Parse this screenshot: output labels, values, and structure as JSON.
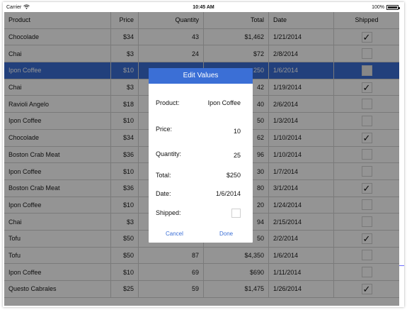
{
  "status_bar": {
    "carrier": "Carrier",
    "time": "10:45 AM",
    "battery": "100%"
  },
  "columns": [
    "Product",
    "Price",
    "Quantity",
    "Total",
    "Date",
    "Shipped"
  ],
  "rows": [
    {
      "product": "Chocolade",
      "price": "$34",
      "quantity": "43",
      "total": "$1,462",
      "date": "1/21/2014",
      "shipped": true
    },
    {
      "product": "Chai",
      "price": "$3",
      "quantity": "24",
      "total": "$72",
      "date": "2/8/2014",
      "shipped": false
    },
    {
      "product": "Ipon Coffee",
      "price": "$10",
      "quantity": "",
      "total": "250",
      "date": "1/6/2014",
      "shipped": false
    },
    {
      "product": "Chai",
      "price": "$3",
      "quantity": "",
      "total": "42",
      "date": "1/19/2014",
      "shipped": true
    },
    {
      "product": "Ravioli Angelo",
      "price": "$18",
      "quantity": "",
      "total": "40",
      "date": "2/6/2014",
      "shipped": false
    },
    {
      "product": "Ipon Coffee",
      "price": "$10",
      "quantity": "",
      "total": "50",
      "date": "1/3/2014",
      "shipped": false
    },
    {
      "product": "Chocolade",
      "price": "$34",
      "quantity": "",
      "total": "62",
      "date": "1/10/2014",
      "shipped": true
    },
    {
      "product": "Boston Crab Meat",
      "price": "$36",
      "quantity": "",
      "total": "96",
      "date": "1/10/2014",
      "shipped": false
    },
    {
      "product": "Ipon Coffee",
      "price": "$10",
      "quantity": "",
      "total": "30",
      "date": "1/7/2014",
      "shipped": false
    },
    {
      "product": "Boston Crab Meat",
      "price": "$36",
      "quantity": "",
      "total": "80",
      "date": "3/1/2014",
      "shipped": true
    },
    {
      "product": "Ipon Coffee",
      "price": "$10",
      "quantity": "",
      "total": "20",
      "date": "1/24/2014",
      "shipped": false
    },
    {
      "product": "Chai",
      "price": "$3",
      "quantity": "",
      "total": "94",
      "date": "2/15/2014",
      "shipped": false
    },
    {
      "product": "Tofu",
      "price": "$50",
      "quantity": "",
      "total": "50",
      "date": "2/2/2014",
      "shipped": true
    },
    {
      "product": "Tofu",
      "price": "$50",
      "quantity": "87",
      "total": "$4,350",
      "date": "1/6/2014",
      "shipped": false
    },
    {
      "product": "Ipon Coffee",
      "price": "$10",
      "quantity": "69",
      "total": "$690",
      "date": "1/11/2014",
      "shipped": false
    },
    {
      "product": "Questo Cabrales",
      "price": "$25",
      "quantity": "59",
      "total": "$1,475",
      "date": "1/26/2014",
      "shipped": true
    }
  ],
  "selected_row": 2,
  "dialog": {
    "title": "Edit Values",
    "product_label": "Product:",
    "product_value": "Ipon Coffee",
    "price_label": "Price:",
    "price_value": "10",
    "quantity_label": "Quantity:",
    "quantity_value": "25",
    "total_label": "Total:",
    "total_value": "$250",
    "date_label": "Date:",
    "date_value": "1/6/2014",
    "shipped_label": "Shipped:",
    "cancel_label": "Cancel",
    "done_label": "Done"
  },
  "colors": {
    "accent": "#3b6fd6",
    "overlay": "rgba(0,0,0,0.42)"
  }
}
